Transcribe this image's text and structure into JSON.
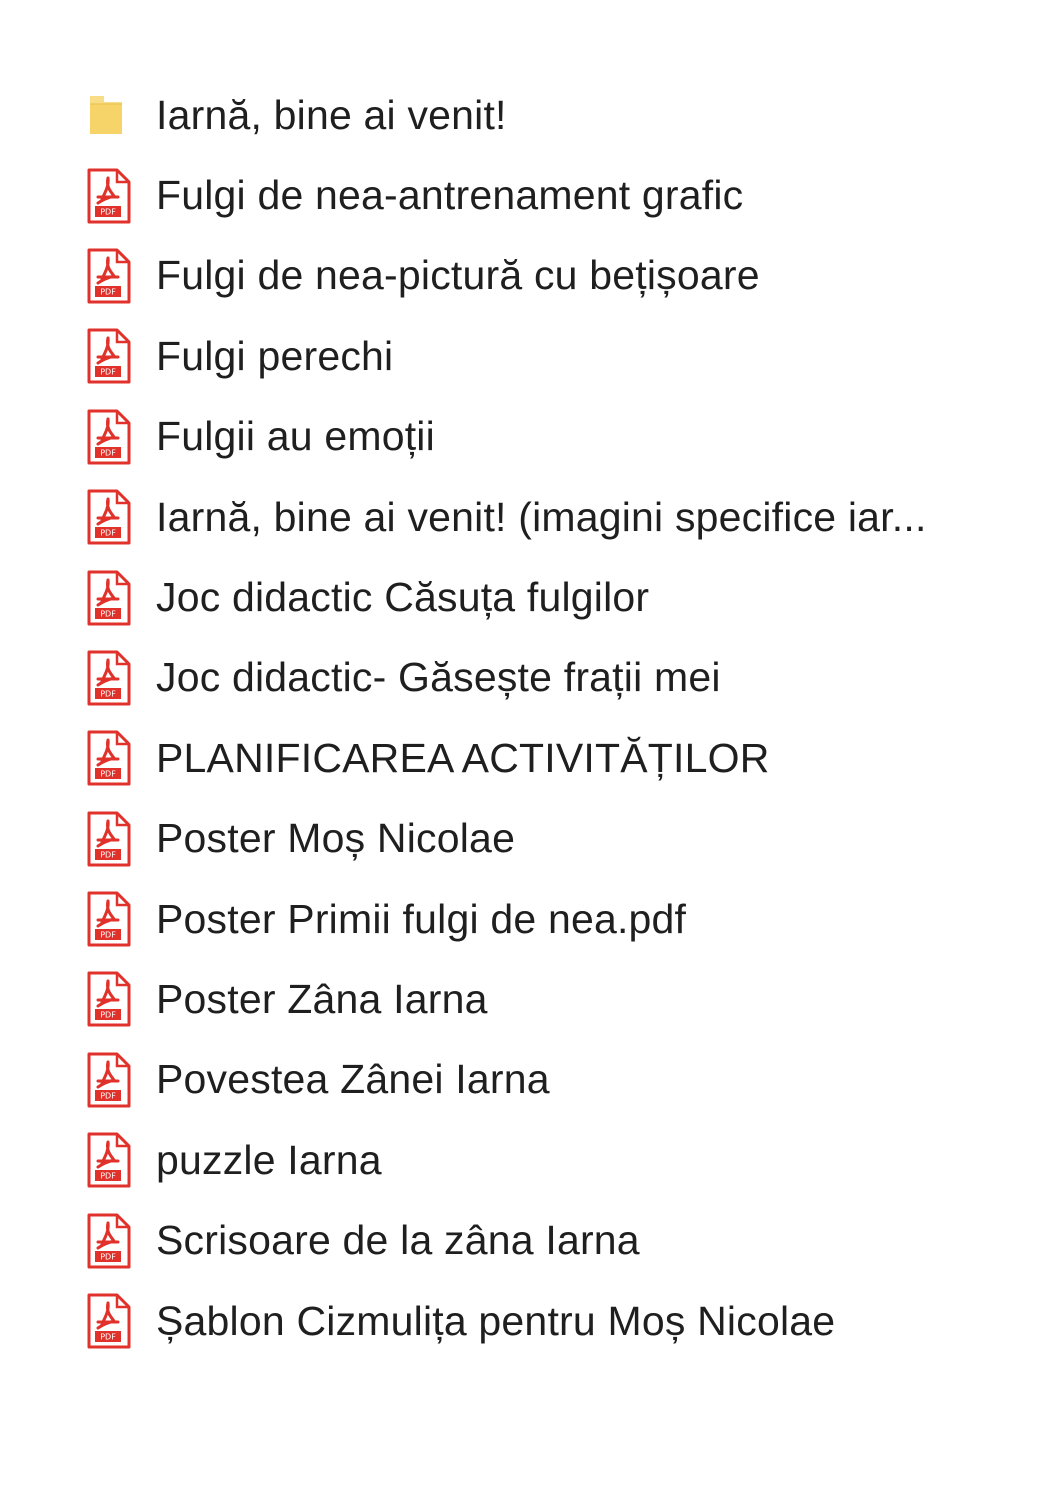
{
  "items": [
    {
      "type": "folder",
      "icon": "folder-icon",
      "name": "Iarnă, bine ai venit!"
    },
    {
      "type": "pdf",
      "icon": "pdf-file-icon",
      "name": "Fulgi de nea-antrenament grafic"
    },
    {
      "type": "pdf",
      "icon": "pdf-file-icon",
      "name": "Fulgi de nea-pictură cu bețișoare"
    },
    {
      "type": "pdf",
      "icon": "pdf-file-icon",
      "name": "Fulgi perechi"
    },
    {
      "type": "pdf",
      "icon": "pdf-file-icon",
      "name": "Fulgii au emoții"
    },
    {
      "type": "pdf",
      "icon": "pdf-file-icon",
      "name": "Iarnă, bine ai venit! (imagini specifice iar..."
    },
    {
      "type": "pdf",
      "icon": "pdf-file-icon",
      "name": "Joc didactic Căsuța fulgilor"
    },
    {
      "type": "pdf",
      "icon": "pdf-file-icon",
      "name": "Joc didactic- Găsește frații mei"
    },
    {
      "type": "pdf",
      "icon": "pdf-file-icon",
      "name": "PLANIFICAREA ACTIVITĂȚILOR"
    },
    {
      "type": "pdf",
      "icon": "pdf-file-icon",
      "name": "Poster Moș Nicolae"
    },
    {
      "type": "pdf",
      "icon": "pdf-file-icon",
      "name": "Poster Primii fulgi de nea.pdf"
    },
    {
      "type": "pdf",
      "icon": "pdf-file-icon",
      "name": "Poster Zâna Iarna"
    },
    {
      "type": "pdf",
      "icon": "pdf-file-icon",
      "name": "Povestea Zânei Iarna"
    },
    {
      "type": "pdf",
      "icon": "pdf-file-icon",
      "name": "puzzle Iarna"
    },
    {
      "type": "pdf",
      "icon": "pdf-file-icon",
      "name": "Scrisoare de la zâna Iarna"
    },
    {
      "type": "pdf",
      "icon": "pdf-file-icon",
      "name": "Șablon Cizmulița pentru Moș Nicolae"
    }
  ],
  "colors": {
    "pdf_red": "#e0322b",
    "folder_yellow": "#f6d46a",
    "text": "#1f1f1f"
  }
}
